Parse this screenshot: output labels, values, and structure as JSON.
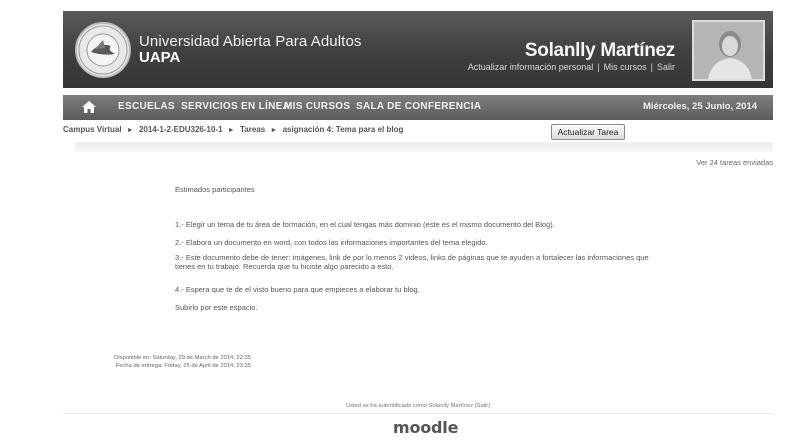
{
  "header": {
    "university_name": "Universidad Abierta Para Adultos",
    "university_short": "UAPA",
    "user_name": "Solanlly Martínez",
    "links": [
      "Actualizar información personal",
      "Mis cursos",
      "Salir"
    ],
    "separator": "|"
  },
  "nav": {
    "items": [
      "ESCUELAS",
      "SERVICIOS EN LÍNEA",
      "MIS CURSOS",
      "SALA DE CONFERENCIA"
    ],
    "date": "Miércoles, 25 Junio, 2014"
  },
  "breadcrumb": [
    "Campus Virtual",
    "2014-1-2-EDU326-10-1",
    "Tareas",
    "asignación 4: Tema para el blog"
  ],
  "breadcrumb_separator": "►",
  "update_button": "Actualizar Tarea",
  "view_submissions": "Ver 24 tareas enviadas",
  "assignment": {
    "greeting": "Estimados participantes",
    "items": [
      "1.- Elegir un tema de tu área de formación, en el cual tengas más dominio (este es el mismo documento del Blog).",
      "2.- Elabora un documento en word, con todos las informaciones importantes del tema elegido.",
      "3.- Este documento debe de tener: imágenes, link de por lo menos 2 videos, links de páginas que te ayuden a fortalecer las informaciones que tienes en tu trabajo. Recuerda que tu hiciste algo parecido a esto.",
      "4.- Espera que te de el visto bueno para que empieces a elaborar tu blog."
    ],
    "closing": "Subirlo por este espacio."
  },
  "dates": {
    "available": "Disponible en: Saturday, 29 de March de 2014, 22:35",
    "due": "Fecha de entrega: Friday, 25 de April de 2014, 23:35"
  },
  "footer": {
    "auth_text": "Usted se ha autentificado como Solanlly Martínez (Salir)",
    "logo": "moodle"
  },
  "colors": {
    "header_bg": "#404040",
    "nav_bg": "#6b6b6b"
  }
}
